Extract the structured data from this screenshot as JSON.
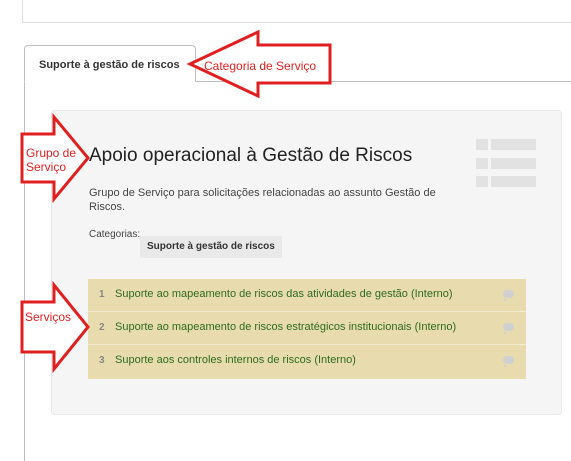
{
  "tab": {
    "label": "Suporte à gestão de riscos"
  },
  "group": {
    "title": "Apoio operacional à Gestão de Riscos",
    "description": "Grupo de Serviço para solicitações relacionadas ao assunto Gestão de Riscos.",
    "categories_label": "Categorias:",
    "category_chip": "Suporte à gestão de riscos"
  },
  "services": [
    {
      "number": "1",
      "name": "Suporte ao mapeamento de riscos das atividades de gestão (Interno)"
    },
    {
      "number": "2",
      "name": "Suporte ao mapeamento de riscos estratégicos institucionais (Interno)"
    },
    {
      "number": "3",
      "name": "Suporte aos controles internos de riscos (Interno)"
    }
  ],
  "annotations": {
    "categoria": "Categoria de Serviço",
    "grupo_line1": "Grupo de",
    "grupo_line2": "Serviço",
    "servicos": "Serviços"
  },
  "colors": {
    "annotation": "#e02020",
    "services_bg": "#e8dcae",
    "service_link": "#2e6b1f"
  }
}
